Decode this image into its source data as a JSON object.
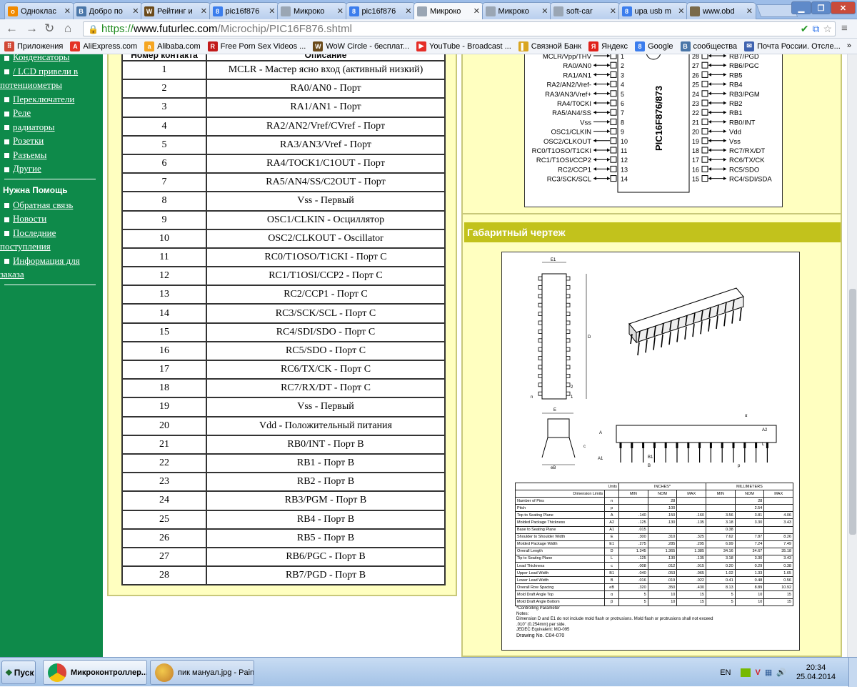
{
  "browser": {
    "tabs": [
      {
        "title": "Одноклас",
        "icon": "odnoklassniki-icon",
        "color": "#f18a00",
        "glyph": "о"
      },
      {
        "title": "Добро по",
        "icon": "vk-icon",
        "color": "#4a76a8",
        "glyph": "В"
      },
      {
        "title": "Рейтинг и",
        "icon": "wow-icon",
        "color": "#6b4a1a",
        "glyph": "W"
      },
      {
        "title": "pic16f876",
        "icon": "google-icon",
        "color": "#3b7ded",
        "glyph": "8"
      },
      {
        "title": "Микроко",
        "icon": "page-icon",
        "color": "#9aa6b4",
        "glyph": ""
      },
      {
        "title": "pic16f876",
        "icon": "google-icon",
        "color": "#3b7ded",
        "glyph": "8"
      },
      {
        "title": "Микроко",
        "icon": "page-icon",
        "color": "#9aa6b4",
        "glyph": ""
      },
      {
        "title": "Микроко",
        "icon": "page-icon",
        "color": "#9aa6b4",
        "glyph": ""
      },
      {
        "title": "soft-car",
        "icon": "page-icon",
        "color": "#9aa6b4",
        "glyph": ""
      },
      {
        "title": "upa usb m",
        "icon": "google-icon",
        "color": "#3b7ded",
        "glyph": "8"
      },
      {
        "title": "www.obd",
        "icon": "site-icon",
        "color": "#7a6a4a",
        "glyph": ""
      }
    ],
    "active_tab_index": 6,
    "url": {
      "scheme": "https://",
      "host": "www.futurlec.com",
      "path": "/Microchip/PIC16F876.shtml"
    },
    "bookmarks": [
      {
        "label": "Приложения",
        "icon": "apps-icon",
        "color": "#d14836",
        "glyph": "⠿"
      },
      {
        "label": "AliExpress.com",
        "icon": "aliexpress-icon",
        "color": "#e43225",
        "glyph": "A"
      },
      {
        "label": "Alibaba.com",
        "icon": "alibaba-icon",
        "color": "#f5a623",
        "glyph": "a"
      },
      {
        "label": "Free Porn Sex Videos ...",
        "icon": "r-icon",
        "color": "#c21a1a",
        "glyph": "R"
      },
      {
        "label": "WoW Circle - бесплат...",
        "icon": "wow-icon",
        "color": "#6b4a1a",
        "glyph": "W"
      },
      {
        "label": "YouTube - Broadcast ...",
        "icon": "youtube-icon",
        "color": "#e52d27",
        "glyph": "▶"
      },
      {
        "label": "Связной Банк",
        "icon": "bank-icon",
        "color": "#d9a520",
        "glyph": "▌"
      },
      {
        "label": "Яндекс",
        "icon": "yandex-icon",
        "color": "#e0201a",
        "glyph": "Я"
      },
      {
        "label": "Google",
        "icon": "google-icon",
        "color": "#3b7ded",
        "glyph": "8"
      },
      {
        "label": "сообщества",
        "icon": "vk-icon",
        "color": "#4a76a8",
        "glyph": "В"
      },
      {
        "label": "Почта России. Отсле...",
        "icon": "post-icon",
        "color": "#3f63b0",
        "glyph": "✉"
      }
    ]
  },
  "sidebar": {
    "items_top": [
      {
        "label": "Конденсаторы",
        "bullet": true
      },
      {
        "label": "/ LCD привели в",
        "bullet": true
      },
      {
        "label": "потенциометры",
        "bullet": false
      },
      {
        "label": "Переключатели",
        "bullet": true
      },
      {
        "label": "Реле",
        "bullet": true
      },
      {
        "label": "радиаторы",
        "bullet": true
      },
      {
        "label": "Розетки",
        "bullet": true
      },
      {
        "label": "Разъемы",
        "bullet": true
      },
      {
        "label": "Другие",
        "bullet": true
      }
    ],
    "help_heading": "Нужна Помощь",
    "items_help": [
      {
        "label": "Обратная связь",
        "bullet": true
      },
      {
        "label": "Новости",
        "bullet": true
      },
      {
        "label": "Последние",
        "bullet": true
      },
      {
        "label": "поступления",
        "bullet": false
      },
      {
        "label": "Информация для",
        "bullet": true
      },
      {
        "label": "заказа",
        "bullet": false
      }
    ]
  },
  "pin_table": {
    "headers": [
      "Номер контакта",
      "Описание"
    ],
    "rows": [
      [
        "1",
        "MCLR - Мастер ясно вход (активный низкий)"
      ],
      [
        "2",
        "RA0/AN0 - Порт"
      ],
      [
        "3",
        "RA1/AN1 - Порт"
      ],
      [
        "4",
        "RA2/AN2/Vref/CVref - Порт"
      ],
      [
        "5",
        "RA3/AN3/Vref - Порт"
      ],
      [
        "6",
        "RA4/TOCK1/C1OUT - Порт"
      ],
      [
        "7",
        "RA5/AN4/SS/C2OUT - Порт"
      ],
      [
        "8",
        "Vss - Первый"
      ],
      [
        "9",
        "OSC1/CLKIN - Осциллятор"
      ],
      [
        "10",
        "OSC2/CLKOUT - Oscillator"
      ],
      [
        "11",
        "RC0/T1OSO/T1CKI - Порт C"
      ],
      [
        "12",
        "RC1/T1OSI/CCP2 - Порт C"
      ],
      [
        "13",
        "RC2/CCP1 - Порт C"
      ],
      [
        "14",
        "RC3/SCK/SCL - Порт C"
      ],
      [
        "15",
        "RC4/SDI/SDO - Порт C"
      ],
      [
        "16",
        "RC5/SDO - Порт C"
      ],
      [
        "17",
        "RC6/TX/CK - Порт C"
      ],
      [
        "18",
        "RC7/RX/DT - Порт C"
      ],
      [
        "19",
        "Vss - Первый"
      ],
      [
        "20",
        "Vdd - Положительный питания"
      ],
      [
        "21",
        "RB0/INT - Порт B"
      ],
      [
        "22",
        "RB1 - Порт B"
      ],
      [
        "23",
        "RB2 - Порт B"
      ],
      [
        "24",
        "RB3/PGM - Порт B"
      ],
      [
        "25",
        "RB4 - Порт B"
      ],
      [
        "26",
        "RB5 - Порт B"
      ],
      [
        "27",
        "RB6/PGC - Порт B"
      ],
      [
        "28",
        "RB7/PGD - Порт B"
      ]
    ]
  },
  "pinout": {
    "chip_label": "PIC16F876/873",
    "left": [
      {
        "n": "1",
        "label": "MCLR/Vpp/THV",
        "dir": "in"
      },
      {
        "n": "2",
        "label": "RA0/AN0",
        "dir": "both"
      },
      {
        "n": "3",
        "label": "RA1/AN1",
        "dir": "both"
      },
      {
        "n": "4",
        "label": "RA2/AN2/Vref-",
        "dir": "both"
      },
      {
        "n": "5",
        "label": "RA3/AN3/Vref+",
        "dir": "both"
      },
      {
        "n": "6",
        "label": "RA4/T0CKI",
        "dir": "both"
      },
      {
        "n": "7",
        "label": "RA5/AN4/SS",
        "dir": "both"
      },
      {
        "n": "8",
        "label": "Vss",
        "dir": "in"
      },
      {
        "n": "9",
        "label": "OSC1/CLKIN",
        "dir": "in"
      },
      {
        "n": "10",
        "label": "OSC2/CLKOUT",
        "dir": "out"
      },
      {
        "n": "11",
        "label": "RC0/T1OSO/T1CKI",
        "dir": "both"
      },
      {
        "n": "12",
        "label": "RC1/T1OSI/CCP2",
        "dir": "both"
      },
      {
        "n": "13",
        "label": "RC2/CCP1",
        "dir": "both"
      },
      {
        "n": "14",
        "label": "RC3/SCK/SCL",
        "dir": "both"
      }
    ],
    "right": [
      {
        "n": "28",
        "label": "RB7/PGD"
      },
      {
        "n": "27",
        "label": "RB6/PGC"
      },
      {
        "n": "26",
        "label": "RB5"
      },
      {
        "n": "25",
        "label": "RB4"
      },
      {
        "n": "24",
        "label": "RB3/PGM"
      },
      {
        "n": "23",
        "label": "RB2"
      },
      {
        "n": "22",
        "label": "RB1"
      },
      {
        "n": "21",
        "label": "RB0/INT"
      },
      {
        "n": "20",
        "label": "Vdd"
      },
      {
        "n": "19",
        "label": "Vss"
      },
      {
        "n": "18",
        "label": "RC7/RX/DT"
      },
      {
        "n": "17",
        "label": "RC6/TX/CK"
      },
      {
        "n": "16",
        "label": "RC5/SDO"
      },
      {
        "n": "15",
        "label": "RC4/SDI/SDA"
      }
    ]
  },
  "drawing_section": {
    "title": "Габаритный чертеж",
    "dimension_table": {
      "group_headers": [
        "Units",
        "INCHES*",
        "MILLIMETERS"
      ],
      "col_headers": [
        "Dimension Limits",
        "",
        "MIN",
        "NOM",
        "MAX",
        "MIN",
        "NOM",
        "MAX"
      ],
      "rows": [
        [
          "Number of Pins",
          "n",
          "",
          "28",
          "",
          "",
          "28",
          ""
        ],
        [
          "Pitch",
          "p",
          "",
          ".100",
          "",
          "",
          "2.54",
          ""
        ],
        [
          "Top to Seating Plane",
          "A",
          ".140",
          ".150",
          ".160",
          "3.56",
          "3.81",
          "4.06"
        ],
        [
          "Molded Package Thickness",
          "A2",
          ".125",
          ".130",
          ".135",
          "3.18",
          "3.30",
          "3.43"
        ],
        [
          "Base to Seating Plane",
          "A1",
          ".015",
          "",
          "",
          "0.38",
          "",
          ""
        ],
        [
          "Shoulder to Shoulder Width",
          "E",
          ".300",
          ".310",
          ".325",
          "7.62",
          "7.87",
          "8.26"
        ],
        [
          "Molded Package Width",
          "E1",
          ".275",
          ".285",
          ".295",
          "6.99",
          "7.24",
          "7.49"
        ],
        [
          "Overall Length",
          "D",
          "1.345",
          "1.365",
          "1.385",
          "34.16",
          "34.67",
          "35.18"
        ],
        [
          "Tip to Seating Plane",
          "L",
          ".125",
          ".130",
          ".135",
          "3.18",
          "3.30",
          "3.43"
        ],
        [
          "Lead Thickness",
          "c",
          ".008",
          ".012",
          ".015",
          "0.20",
          "0.29",
          "0.38"
        ],
        [
          "Upper Lead Width",
          "B1",
          ".040",
          ".053",
          ".065",
          "1.02",
          "1.33",
          "1.65"
        ],
        [
          "Lower Lead Width",
          "B",
          ".016",
          ".019",
          ".022",
          "0.41",
          "0.48",
          "0.56"
        ],
        [
          "Overall Row Spacing",
          "eB",
          ".320",
          ".350",
          ".430",
          "8.13",
          "8.89",
          "10.92"
        ],
        [
          "Mold Draft Angle Top",
          "α",
          "5",
          "10",
          "15",
          "5",
          "10",
          "15"
        ],
        [
          "Mold Draft Angle Bottom",
          "β",
          "5",
          "10",
          "15",
          "5",
          "10",
          "15"
        ]
      ]
    },
    "notes": [
      "*Controlling Parameter",
      "Notes:",
      "Dimension D and E1 do not include mold flash or protrusions. Mold flash or protrusions shall not exceed",
      ".010\" (0.254mm) per side.",
      "JEDEC Equivalent:  MO-095",
      "Drawing No. C04-070"
    ],
    "dim_labels": [
      "E1",
      "D",
      "n",
      "1",
      "2",
      "E",
      "c",
      "eB",
      "α",
      "A2",
      "A",
      "L",
      "A1",
      "B1",
      "B",
      "p",
      "β"
    ]
  },
  "taskbar": {
    "start_label": "Пуск",
    "items": [
      {
        "label": "Микроконтроллер...",
        "icon": "chrome-icon",
        "active": true
      },
      {
        "label": "пик мануал.jpg - Paint",
        "icon": "paint-icon",
        "active": false
      }
    ],
    "lang": "EN",
    "time": "20:34",
    "date": "25.04.2014"
  }
}
